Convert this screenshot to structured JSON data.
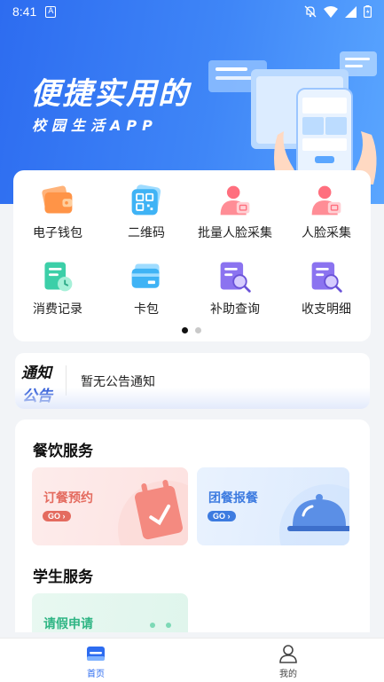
{
  "status_bar": {
    "time": "8:41",
    "notification_letter": "A"
  },
  "hero": {
    "title": "便捷实用的",
    "subtitle": "校园生活APP"
  },
  "quick_grid": {
    "items": [
      {
        "label": "电子钱包",
        "icon": "wallet-icon"
      },
      {
        "label": "二维码",
        "icon": "qr-code-icon"
      },
      {
        "label": "批量人脸采集",
        "icon": "batch-face-capture-icon"
      },
      {
        "label": "人脸采集",
        "icon": "face-capture-icon"
      },
      {
        "label": "消费记录",
        "icon": "consumption-record-icon"
      },
      {
        "label": "卡包",
        "icon": "card-pack-icon"
      },
      {
        "label": "补助查询",
        "icon": "subsidy-query-icon"
      },
      {
        "label": "收支明细",
        "icon": "income-expense-icon"
      }
    ],
    "page_count": 2,
    "active_page": 0
  },
  "notice": {
    "tag_line1": "通知",
    "tag_line2": "公告",
    "text": "暂无公告通知"
  },
  "catering": {
    "title": "餐饮服务",
    "cards": [
      {
        "label": "订餐预约",
        "go": "GO",
        "color": "#e46b5f"
      },
      {
        "label": "团餐报餐",
        "go": "GO",
        "color": "#3d7be0"
      }
    ]
  },
  "student": {
    "title": "学生服务",
    "cards": [
      {
        "label": "请假申请",
        "color": "#2fb584"
      }
    ]
  },
  "tabbar": {
    "tabs": [
      {
        "label": "首页",
        "active": true,
        "icon": "home-icon"
      },
      {
        "label": "我的",
        "active": false,
        "icon": "user-icon"
      }
    ]
  },
  "colors": {
    "brand": "#2d6cf0"
  }
}
